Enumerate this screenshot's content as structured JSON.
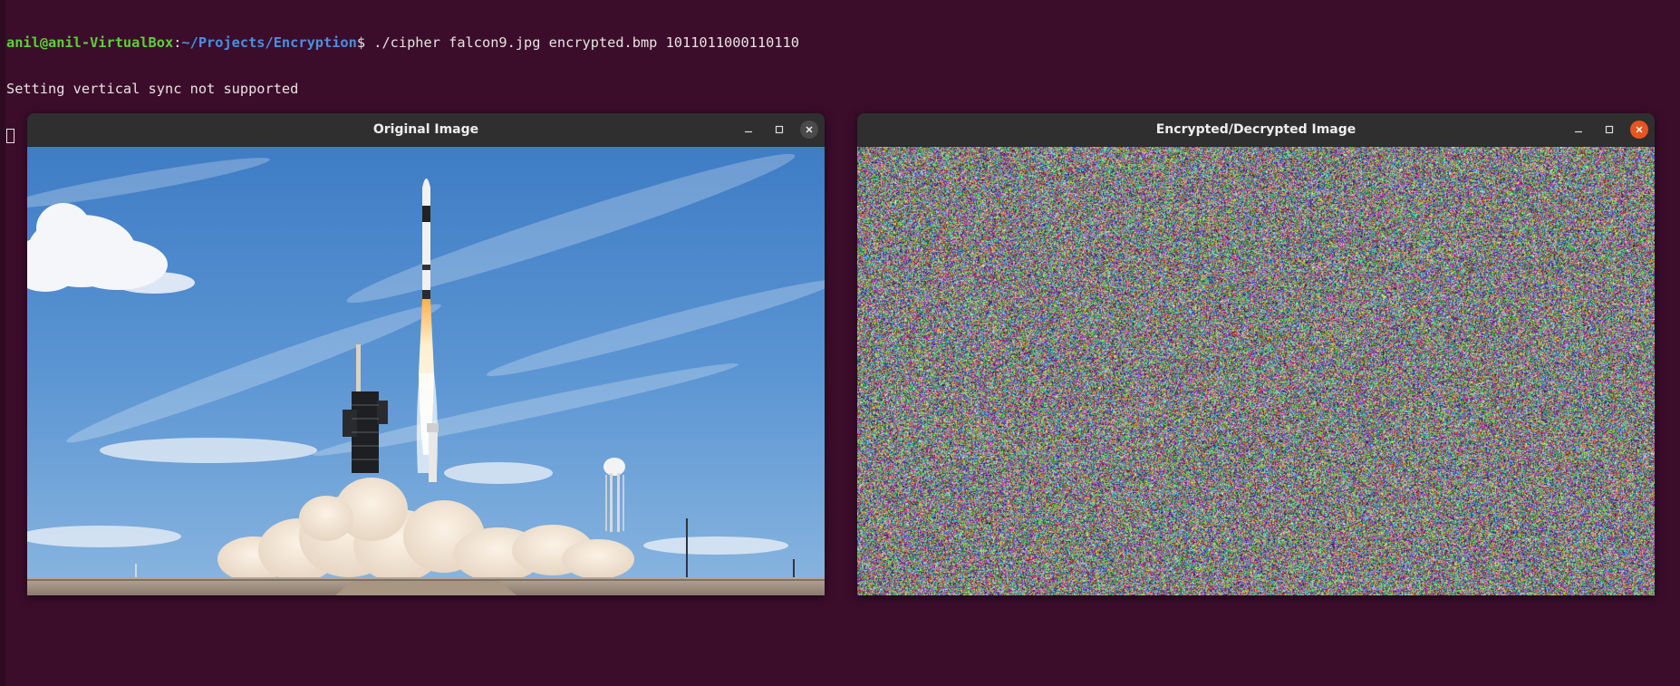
{
  "terminal": {
    "prompt_user": "anil@anil-VirtualBox",
    "prompt_colon": ":",
    "prompt_path": "~/Projects/Encryption",
    "prompt_dollar": "$",
    "command": " ./cipher falcon9.jpg encrypted.bmp 1011011000110110",
    "output": "Setting vertical sync not supported"
  },
  "windows": {
    "original": {
      "title": "Original Image",
      "buttons": [
        "minimize-icon",
        "maximize-icon",
        "close-icon"
      ]
    },
    "encrypted": {
      "title": "Encrypted/Decrypted Image",
      "buttons": [
        "minimize-icon",
        "maximize-icon",
        "close-icon"
      ]
    }
  },
  "colors": {
    "desktop_bg": "#3b0d2b",
    "prompt_user": "#5ad13a",
    "prompt_path": "#4a8fe0",
    "titlebar": "#2f2f2f",
    "close_active": "#e95420",
    "sky": "#4f8fd0"
  },
  "icons": {
    "minimize": "minimize-icon",
    "maximize": "maximize-icon",
    "close": "close-icon"
  }
}
